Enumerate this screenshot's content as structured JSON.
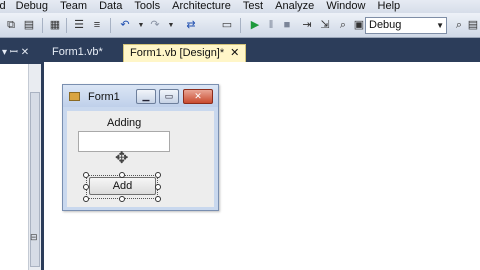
{
  "menu": [
    "ld",
    "Debug",
    "Team",
    "Data",
    "Tools",
    "Architecture",
    "Test",
    "Analyze",
    "Window",
    "Help"
  ],
  "toolbar": {
    "configuration": "Debug",
    "icons": [
      "copy-icon",
      "paste-icon",
      "print-icon",
      "align-icon",
      "undo-icon",
      "redo-icon",
      "navigate-icon",
      "start-debug-icon",
      "pause-icon",
      "stop-icon",
      "bookmark-icon",
      "find-icon"
    ]
  },
  "tabs": [
    {
      "label": "Form1.vb*",
      "active": false
    },
    {
      "label": "Form1.vb [Design]*",
      "active": true
    }
  ],
  "panel": {
    "pin": "▾ ꟷ ✕"
  },
  "form": {
    "title": "Form1",
    "label": "Adding",
    "textbox_value": "",
    "button": "Add"
  },
  "colors": {
    "dock_background": "#2c3d5a",
    "active_tab": "#fff6c8",
    "close_button": "#c94a2f"
  }
}
